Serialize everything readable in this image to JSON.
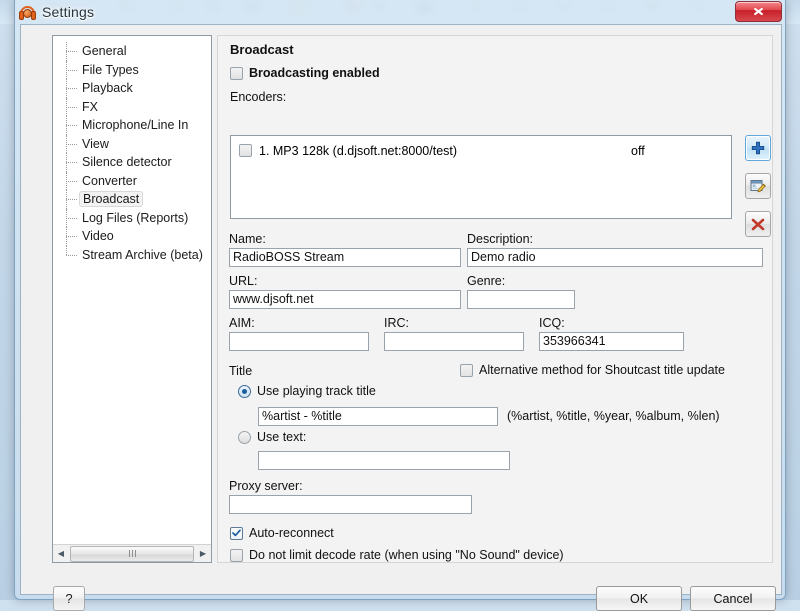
{
  "window": {
    "title": "Settings",
    "app_icon": "headphones-icon",
    "close_label": "Close"
  },
  "sidebar": {
    "items": [
      {
        "label": "General",
        "selected": false
      },
      {
        "label": "File Types",
        "selected": false
      },
      {
        "label": "Playback",
        "selected": false
      },
      {
        "label": "FX",
        "selected": false
      },
      {
        "label": "Microphone/Line In",
        "selected": false
      },
      {
        "label": "View",
        "selected": false
      },
      {
        "label": "Silence detector",
        "selected": false
      },
      {
        "label": "Converter",
        "selected": false
      },
      {
        "label": "Broadcast",
        "selected": true
      },
      {
        "label": "Log Files (Reports)",
        "selected": false
      },
      {
        "label": "Video",
        "selected": false
      },
      {
        "label": "Stream Archive (beta)",
        "selected": false
      }
    ],
    "scroll_left_icon": "triangle-left-icon",
    "scroll_right_icon": "triangle-right-icon"
  },
  "panel": {
    "title": "Broadcast",
    "broadcasting_enabled": {
      "label": "Broadcasting enabled",
      "checked": false
    },
    "encoders": {
      "label": "Encoders:",
      "rows": [
        {
          "checked": false,
          "name": "1. MP3 128k (d.djsoft.net:8000/test)",
          "state": "off"
        }
      ],
      "buttons": [
        {
          "name": "add-encoder-button",
          "icon": "plus-icon"
        },
        {
          "name": "edit-encoder-button",
          "icon": "pencil-edit-icon"
        },
        {
          "name": "delete-encoder-button",
          "icon": "red-x-icon"
        }
      ]
    },
    "fields": {
      "name": {
        "label": "Name:",
        "value": "RadioBOSS Stream",
        "placeholder": ""
      },
      "description": {
        "label": "Description:",
        "value": "Demo radio",
        "placeholder": ""
      },
      "url": {
        "label": "URL:",
        "value": "www.djsoft.net",
        "placeholder": ""
      },
      "genre": {
        "label": "Genre:",
        "value": "",
        "placeholder": ""
      },
      "aim": {
        "label": "AIM:",
        "value": "",
        "placeholder": ""
      },
      "irc": {
        "label": "IRC:",
        "value": "",
        "placeholder": ""
      },
      "icq": {
        "label": "ICQ:",
        "value": "353966341",
        "placeholder": ""
      }
    },
    "title_section": {
      "legend": "Title",
      "alt_method": {
        "label": "Alternative method for Shoutcast title update",
        "checked": false
      },
      "use_playing_track": {
        "label": "Use playing track title",
        "selected": true
      },
      "pattern_value": "%artist - %title",
      "pattern_hint": "(%artist, %title, %year, %album, %len)",
      "use_text": {
        "label": "Use text:",
        "selected": false
      },
      "text_value": ""
    },
    "proxy": {
      "label": "Proxy server:",
      "value": "",
      "placeholder": ""
    },
    "auto_reconnect": {
      "label": "Auto-reconnect",
      "checked": true
    },
    "no_decode_limit": {
      "label": "Do not limit decode rate (when using \"No Sound\" device)",
      "checked": false
    }
  },
  "footer": {
    "help_label": "?",
    "ok_label": "OK",
    "cancel_label": "Cancel"
  },
  "colors": {
    "accent": "#1c5fa0",
    "delete": "#c0392b",
    "close": "#c81f28"
  }
}
